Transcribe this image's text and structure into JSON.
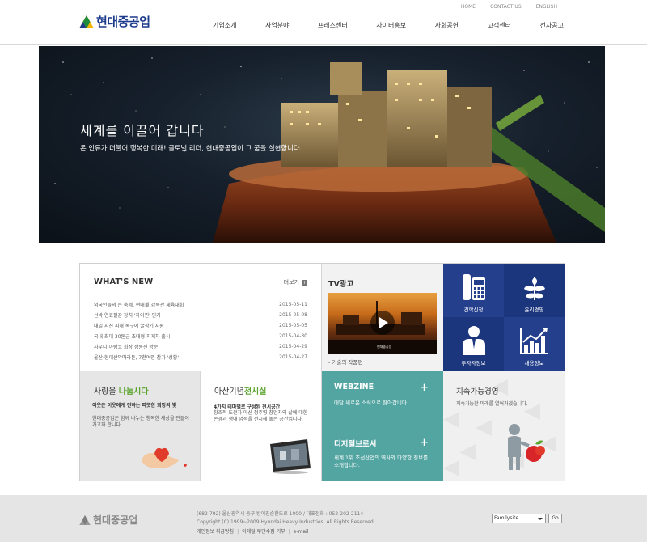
{
  "header": {
    "logo_text": "현대중공업",
    "util_nav": [
      "HOME",
      "CONTACT US",
      "ENGLISH"
    ],
    "main_nav": [
      "기업소개",
      "사업분야",
      "프레스센터",
      "사이버홍보",
      "사회공헌",
      "고객센터",
      "전자공고"
    ]
  },
  "hero": {
    "title": "세계를 이끌어 갑니다",
    "subtitle": "온 인류가 더불어 행복한 미래! 글로벌 리더, 현대중공업이 그 꿈을 실현합니다."
  },
  "whats_new": {
    "title": "WHAT'S NEW",
    "more_label": "더보기",
    "items": [
      {
        "title": "외국인들의 큰 축제, 현대重 감독관 체육대회",
        "date": "2015-05-11"
      },
      {
        "title": "선박 연료절감 장치 '하이핀' 인기",
        "date": "2015-05-08"
      },
      {
        "title": "내일 지진 피해 복구에 굴삭기 지원",
        "date": "2015-05-05"
      },
      {
        "title": "국내 최대 30톤급 초대형 지게차 출시",
        "date": "2015-04-30"
      },
      {
        "title": "사우디 아람코 회장 정몽진 방문",
        "date": "2015-04-29"
      },
      {
        "title": "울산·현대산악마라톤, 7천여명 참가 '성황'",
        "date": "2015-04-27"
      }
    ]
  },
  "tv": {
    "title": "TV광고",
    "thumb_brand": "현대중공업",
    "caption": "- 기술의 작품편"
  },
  "quick_links": [
    {
      "label": "견학신청",
      "icon": "phone-icon"
    },
    {
      "label": "윤리경영",
      "icon": "leaf-icon"
    },
    {
      "label": "투자자정보",
      "icon": "person-icon"
    },
    {
      "label": "채용정보",
      "icon": "chart-icon"
    }
  ],
  "share": {
    "title_plain": "사랑을 ",
    "title_highlight": "나눕시다",
    "sub": "이웃은 이웃에게 전하는 따뜻한 희망의 빛",
    "body": "현대중공업은 함께 나누는 행복한 세상을 만들어 가고자 합니다."
  },
  "asan": {
    "title_plain": "아산기념",
    "title_highlight": "전시실",
    "sub": "4가지 테마별로 구성된 전시공간",
    "body": "창조적 도전자 아산 정주영 창업자의 삶에 대한 존경과 생애 업적을 전시해 놓은 공간입니다."
  },
  "webzine": {
    "title": "WEBZINE",
    "plus": "+",
    "body": "매달 새로운 소식으로 찾아갑니다."
  },
  "digital": {
    "title": "디지털브로셔",
    "plus": "+",
    "body": "세계 1위 조선산업의 역사와 다양한 정보를 소개합니다."
  },
  "sustain": {
    "title": "지속가능경영",
    "body": "지속가능한 미래를 열어가겠습니다."
  },
  "footer": {
    "logo_text": "현대중공업",
    "address": "(682-792) 울산광역시 동구 방어진순환도로 1000 / 대표전화 : 052-202-2114",
    "copyright": "Copyright (C) 1999~2009 Hyundai Heavy Industries. All Rights Reserved.",
    "links": [
      "개인정보 취급방침",
      "이메일 무단수집 거부",
      "e-mail"
    ],
    "familysite_label": "Familysite",
    "go_label": "Go"
  },
  "colors": {
    "brand_blue": "#1d3b8c",
    "teal": "#53a5a2",
    "green_highlight": "#5ea530"
  }
}
